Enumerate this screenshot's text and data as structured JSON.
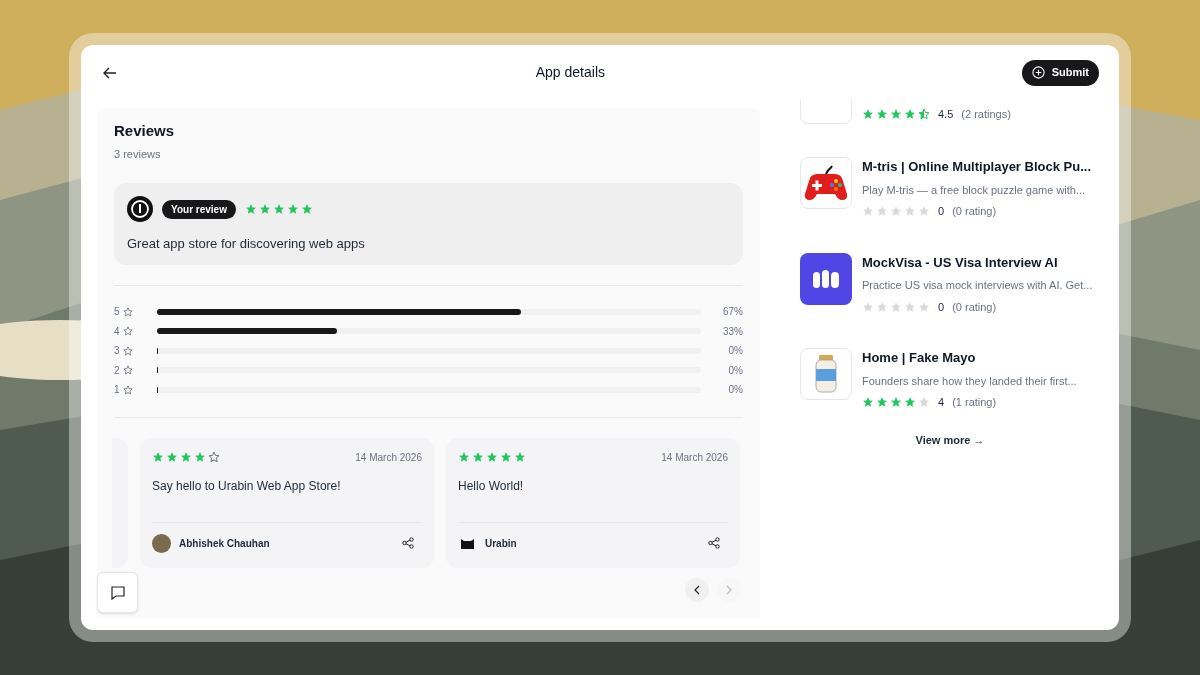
{
  "header": {
    "title": "App details",
    "submit_label": "Submit"
  },
  "reviews": {
    "title": "Reviews",
    "count": "3 reviews",
    "your_review": {
      "badge": "Your review",
      "stars": 5,
      "text": "Great app store for discovering web apps"
    },
    "distribution": [
      {
        "label": "5",
        "level": 0.67,
        "percent": "67%"
      },
      {
        "label": "4",
        "level": 0.33,
        "percent": "33%"
      },
      {
        "label": "3",
        "level": 0,
        "percent": "0%"
      },
      {
        "label": "2",
        "level": 0,
        "percent": "0%"
      },
      {
        "label": "1",
        "level": 0,
        "percent": "0%"
      }
    ],
    "cards": [
      {
        "stars": 4,
        "date": "14 March 2026",
        "text": "Say hello to Urabin Web App Store!",
        "author": "Abhishek Chauhan"
      },
      {
        "stars": 5,
        "date": "14 March 2026",
        "text": "Hello World!",
        "author": "Urabin"
      }
    ],
    "pagination": {
      "prev_disabled": false,
      "next_disabled": true
    }
  },
  "related_apps": [
    {
      "kind": "partial",
      "stars": 4.5,
      "rating": "4.5",
      "count": "(2 ratings)"
    },
    {
      "kind": "full",
      "title": "M-tris | Online Multiplayer Block Pu...",
      "description": "Play M-tris — a free block puzzle game with...",
      "stars": 0,
      "rating": "0",
      "count": "(0 rating)"
    },
    {
      "kind": "full",
      "title": "MockVisa - US Visa Interview AI",
      "description": "Practice US visa mock interviews with AI. Get...",
      "stars": 0,
      "rating": "0",
      "count": "(0 rating)"
    },
    {
      "kind": "full",
      "title": "Home | Fake Mayo",
      "description": "Founders share how they landed their first...",
      "stars": 4,
      "rating": "4",
      "count": "(1 rating)"
    }
  ],
  "view_more": "View more →"
}
